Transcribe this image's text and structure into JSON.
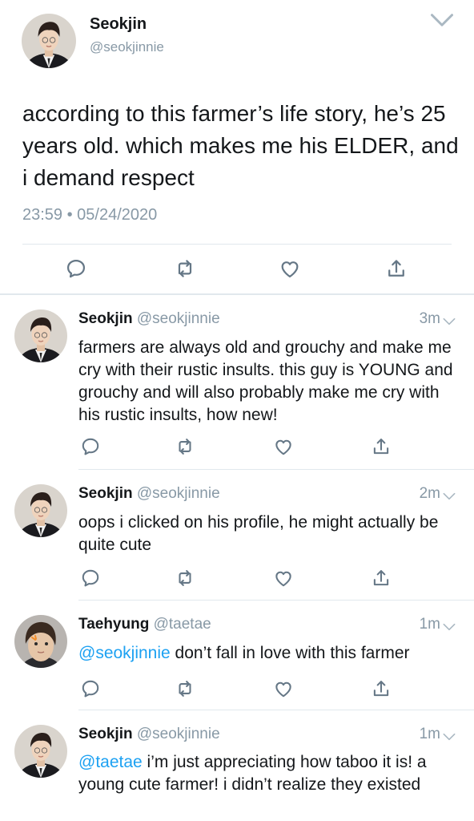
{
  "main_tweet": {
    "name": "Seokjin",
    "handle": "@seokjinnie",
    "text": "according to this farmer’s life story, he’s 25 years old. which makes me his ELDER, and i demand respect",
    "timestamp": "23:59 • 05/24/2020"
  },
  "replies": [
    {
      "name": "Seokjin",
      "handle": "@seokjinnie",
      "time": "3m",
      "mention": "",
      "text": "farmers are always old and grouchy and make me cry with their rustic insults. this guy is YOUNG and grouchy and will also probably make me cry with his rustic insults, how new!"
    },
    {
      "name": "Seokjin",
      "handle": "@seokjinnie",
      "time": "2m",
      "mention": "",
      "text": "oops i clicked on his profile, he might actually be quite cute"
    },
    {
      "name": "Taehyung",
      "handle": "@taetae",
      "time": "1m",
      "mention": "@seokjinnie",
      "text": " don’t fall in love with this farmer"
    },
    {
      "name": "Seokjin",
      "handle": "@seokjinnie",
      "time": "1m",
      "mention": "@taetae",
      "text": " i’m just appreciating how taboo it is! a young cute farmer! i didn’t realize they existed"
    }
  ],
  "colors": {
    "text": "#14171a",
    "muted": "#8899a6",
    "mention": "#1da1f2",
    "divider": "#e1e8ed"
  },
  "icons": [
    "reply-icon",
    "retweet-icon",
    "like-icon",
    "share-icon",
    "chevron-down-icon"
  ]
}
